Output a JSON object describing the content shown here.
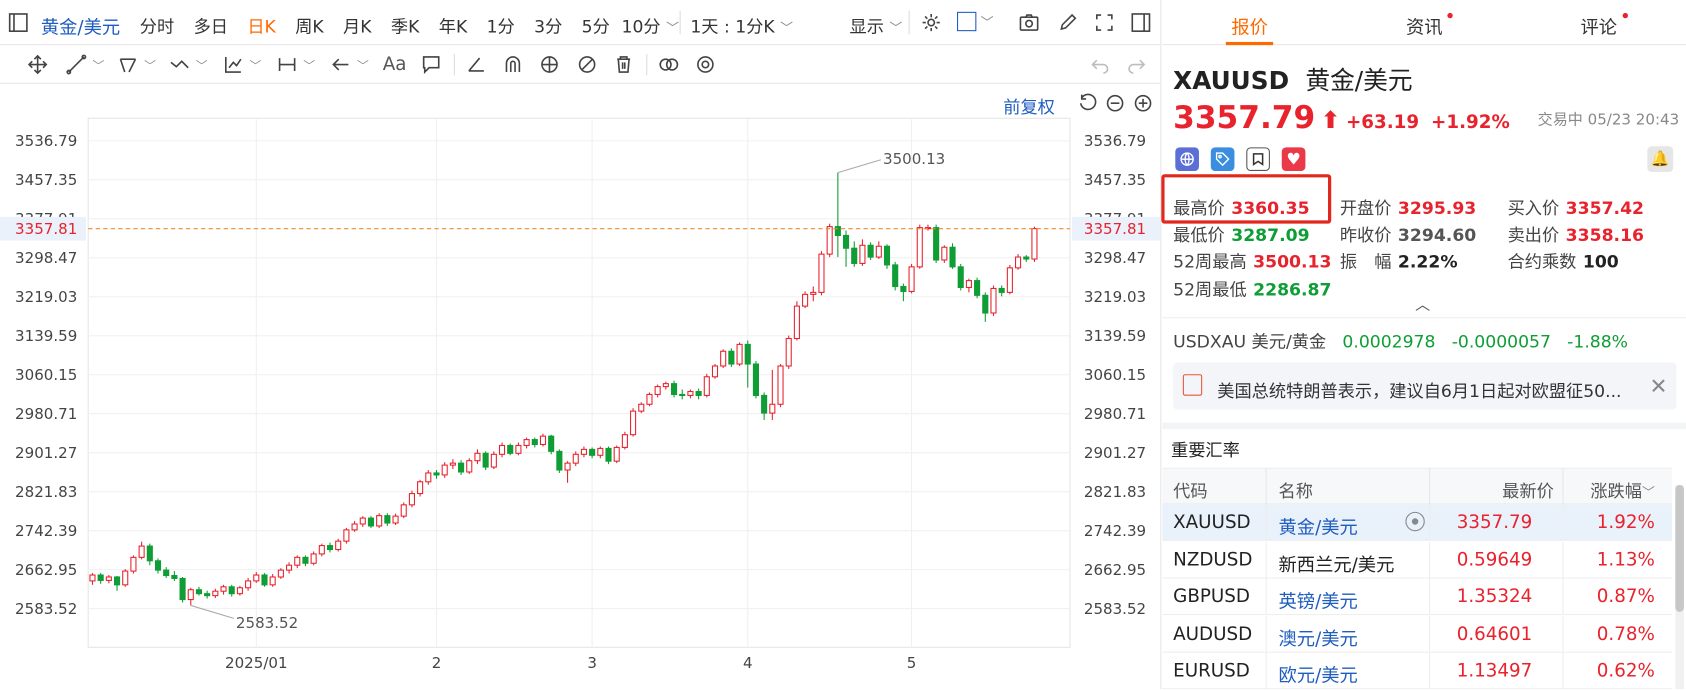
{
  "toolbar": {
    "symbol_pair": "黄金/美元",
    "periods": [
      "分时",
      "多日",
      "日K",
      "周K",
      "月K",
      "季K",
      "年K",
      "1分",
      "3分",
      "5分"
    ],
    "active_period": "日K",
    "dropdown_period": "10分",
    "range_select": "1天 : 1分K",
    "display_label": "显示"
  },
  "chart": {
    "adjust_label": "前复权",
    "price_line_label": "3357.81",
    "high_annotation": "3500.13",
    "low_annotation": "2583.52"
  },
  "chart_data": {
    "type": "candlestick",
    "y_ticks": [
      "3536.79",
      "3457.35",
      "3377.91",
      "3298.47",
      "3219.03",
      "3139.59",
      "3060.15",
      "2980.71",
      "2901.27",
      "2821.83",
      "2742.39",
      "2662.95",
      "2583.52"
    ],
    "ylim": [
      2583.52,
      3536.79
    ],
    "x_ticks": [
      "2025/01",
      "2",
      "3",
      "4",
      "5"
    ],
    "x_tick_index": [
      20,
      42,
      61,
      80,
      100
    ],
    "current_price": 3357.81,
    "candles": [
      [
        2640,
        2652,
        2632,
        2656
      ],
      [
        2652,
        2641,
        2634,
        2656
      ],
      [
        2641,
        2648,
        2635,
        2652
      ],
      [
        2648,
        2632,
        2620,
        2650
      ],
      [
        2632,
        2660,
        2628,
        2664
      ],
      [
        2660,
        2688,
        2655,
        2692
      ],
      [
        2688,
        2711,
        2684,
        2720
      ],
      [
        2711,
        2681,
        2672,
        2716
      ],
      [
        2681,
        2662,
        2655,
        2686
      ],
      [
        2662,
        2651,
        2646,
        2668
      ],
      [
        2651,
        2645,
        2640,
        2660
      ],
      [
        2645,
        2602,
        2596,
        2648
      ],
      [
        2602,
        2622,
        2590,
        2626
      ],
      [
        2622,
        2614,
        2610,
        2628
      ],
      [
        2614,
        2610,
        2604,
        2620
      ],
      [
        2610,
        2619,
        2605,
        2624
      ],
      [
        2619,
        2628,
        2612,
        2632
      ],
      [
        2628,
        2614,
        2608,
        2632
      ],
      [
        2614,
        2626,
        2610,
        2630
      ],
      [
        2626,
        2640,
        2620,
        2646
      ],
      [
        2640,
        2652,
        2636,
        2658
      ],
      [
        2652,
        2632,
        2628,
        2656
      ],
      [
        2632,
        2648,
        2628,
        2654
      ],
      [
        2648,
        2662,
        2644,
        2666
      ],
      [
        2662,
        2672,
        2655,
        2678
      ],
      [
        2672,
        2688,
        2666,
        2692
      ],
      [
        2688,
        2676,
        2670,
        2692
      ],
      [
        2676,
        2695,
        2672,
        2700
      ],
      [
        2695,
        2712,
        2690,
        2716
      ],
      [
        2712,
        2704,
        2698,
        2718
      ],
      [
        2704,
        2721,
        2700,
        2726
      ],
      [
        2721,
        2744,
        2716,
        2748
      ],
      [
        2744,
        2756,
        2740,
        2762
      ],
      [
        2756,
        2768,
        2750,
        2772
      ],
      [
        2768,
        2752,
        2748,
        2772
      ],
      [
        2752,
        2773,
        2748,
        2778
      ],
      [
        2773,
        2758,
        2752,
        2778
      ],
      [
        2758,
        2772,
        2754,
        2777
      ],
      [
        2772,
        2795,
        2768,
        2800
      ],
      [
        2795,
        2818,
        2790,
        2824
      ],
      [
        2818,
        2842,
        2812,
        2846
      ],
      [
        2842,
        2860,
        2836,
        2866
      ],
      [
        2860,
        2856,
        2848,
        2866
      ],
      [
        2856,
        2876,
        2850,
        2882
      ],
      [
        2876,
        2880,
        2868,
        2888
      ],
      [
        2880,
        2862,
        2856,
        2886
      ],
      [
        2862,
        2885,
        2858,
        2890
      ],
      [
        2885,
        2900,
        2878,
        2908
      ],
      [
        2900,
        2872,
        2866,
        2904
      ],
      [
        2872,
        2898,
        2868,
        2904
      ],
      [
        2898,
        2916,
        2892,
        2922
      ],
      [
        2916,
        2900,
        2896,
        2920
      ],
      [
        2900,
        2916,
        2896,
        2922
      ],
      [
        2916,
        2928,
        2910,
        2932
      ],
      [
        2928,
        2918,
        2912,
        2932
      ],
      [
        2918,
        2935,
        2914,
        2940
      ],
      [
        2935,
        2904,
        2898,
        2938
      ],
      [
        2904,
        2866,
        2860,
        2908
      ],
      [
        2866,
        2880,
        2840,
        2884
      ],
      [
        2880,
        2898,
        2874,
        2904
      ],
      [
        2898,
        2908,
        2892,
        2914
      ],
      [
        2908,
        2896,
        2890,
        2912
      ],
      [
        2896,
        2910,
        2890,
        2914
      ],
      [
        2910,
        2884,
        2878,
        2914
      ],
      [
        2884,
        2912,
        2880,
        2916
      ],
      [
        2912,
        2938,
        2908,
        2944
      ],
      [
        2938,
        2986,
        2934,
        2992
      ],
      [
        2986,
        3000,
        2982,
        3004
      ],
      [
        3000,
        3020,
        2996,
        3024
      ],
      [
        3020,
        3036,
        3014,
        3040
      ],
      [
        3036,
        3042,
        3030,
        3046
      ],
      [
        3042,
        3020,
        3014,
        3048
      ],
      [
        3020,
        3018,
        3010,
        3030
      ],
      [
        3018,
        3026,
        3012,
        3030
      ],
      [
        3026,
        3018,
        3010,
        3032
      ],
      [
        3018,
        3056,
        3014,
        3062
      ],
      [
        3056,
        3078,
        3052,
        3082
      ],
      [
        3078,
        3108,
        3074,
        3112
      ],
      [
        3108,
        3082,
        3076,
        3114
      ],
      [
        3082,
        3122,
        3078,
        3126
      ],
      [
        3122,
        3082,
        3034,
        3130
      ],
      [
        3082,
        3018,
        3012,
        3088
      ],
      [
        3018,
        2982,
        2968,
        3024
      ],
      [
        2982,
        3000,
        2968,
        3070
      ],
      [
        3000,
        3078,
        2994,
        3082
      ],
      [
        3078,
        3134,
        3072,
        3140
      ],
      [
        3134,
        3200,
        3130,
        3210
      ],
      [
        3200,
        3224,
        3196,
        3230
      ],
      [
        3224,
        3228,
        3210,
        3240
      ],
      [
        3228,
        3306,
        3222,
        3312
      ],
      [
        3306,
        3362,
        3300,
        3368
      ],
      [
        3362,
        3344,
        3300,
        3472
      ],
      [
        3344,
        3318,
        3280,
        3354
      ],
      [
        3318,
        3287,
        3280,
        3332
      ],
      [
        3287,
        3324,
        3282,
        3336
      ],
      [
        3324,
        3300,
        3294,
        3330
      ],
      [
        3300,
        3322,
        3296,
        3332
      ],
      [
        3322,
        3284,
        3276,
        3326
      ],
      [
        3284,
        3240,
        3232,
        3290
      ],
      [
        3240,
        3230,
        3210,
        3246
      ],
      [
        3230,
        3280,
        3226,
        3286
      ],
      [
        3280,
        3360,
        3276,
        3366
      ],
      [
        3360,
        3360,
        3354,
        3366
      ],
      [
        3360,
        3294,
        3288,
        3366
      ],
      [
        3294,
        3320,
        3288,
        3324
      ],
      [
        3320,
        3280,
        3276,
        3328
      ],
      [
        3280,
        3238,
        3232,
        3286
      ],
      [
        3238,
        3252,
        3228,
        3256
      ],
      [
        3252,
        3222,
        3216,
        3258
      ],
      [
        3222,
        3186,
        3168,
        3228
      ],
      [
        3186,
        3236,
        3180,
        3242
      ],
      [
        3236,
        3228,
        3220,
        3242
      ],
      [
        3228,
        3278,
        3224,
        3284
      ],
      [
        3278,
        3300,
        3274,
        3306
      ],
      [
        3300,
        3296,
        3290,
        3304
      ],
      [
        3296,
        3358,
        3290,
        3362
      ]
    ]
  },
  "quote": {
    "tabs": [
      {
        "label": "报价",
        "active": true
      },
      {
        "label": "资讯",
        "dot": true
      },
      {
        "label": "评论",
        "dot": true
      }
    ],
    "code": "XAUUSD",
    "name": "黄金/美元",
    "price": "3357.79",
    "change": "+63.19",
    "change_pct": "+1.92%",
    "status": "交易中 05/23 20:43",
    "stats": [
      {
        "label": "最高价",
        "value": "3360.35",
        "color": "red"
      },
      {
        "label": "开盘价",
        "value": "3295.93",
        "color": "red"
      },
      {
        "label": "买入价",
        "value": "3357.42",
        "color": "red"
      },
      {
        "label": "最低价",
        "value": "3287.09",
        "color": "green"
      },
      {
        "label": "昨收价",
        "value": "3294.60",
        "color": "gray"
      },
      {
        "label": "卖出价",
        "value": "3358.16",
        "color": "red"
      },
      {
        "label": "52周最高",
        "value": "3500.13",
        "color": "red"
      },
      {
        "label": "振　幅",
        "value": "2.22%",
        "color": "dark"
      },
      {
        "label": "合约乘数",
        "value": "100",
        "color": "dark"
      },
      {
        "label": "52周最低",
        "value": "2286.87",
        "color": "green"
      }
    ],
    "inverse": {
      "code": "USDXAU",
      "name": "美元/黄金",
      "price": "0.0002978",
      "change": "-0.0000057",
      "pct": "-1.88%"
    },
    "news": "美国总统特朗普表示，建议自6月1日起对欧盟征50..."
  },
  "rates": {
    "title": "重要汇率",
    "headers": {
      "code": "代码",
      "name": "名称",
      "price": "最新价",
      "chg": "涨跌幅"
    },
    "rows": [
      {
        "code": "XAUUSD",
        "name": "黄金/美元",
        "price": "3357.79",
        "chg": "1.92%",
        "link": true
      },
      {
        "code": "NZDUSD",
        "name": "新西兰元/美元",
        "price": "0.59649",
        "chg": "1.13%",
        "link": false
      },
      {
        "code": "GBPUSD",
        "name": "英镑/美元",
        "price": "1.35324",
        "chg": "0.87%",
        "link": true
      },
      {
        "code": "AUDUSD",
        "name": "澳元/美元",
        "price": "0.64601",
        "chg": "0.78%",
        "link": true
      },
      {
        "code": "EURUSD",
        "name": "欧元/美元",
        "price": "1.13497",
        "chg": "0.62%",
        "link": true
      }
    ]
  },
  "colors": {
    "up": "#e8232d",
    "down": "#0f9d35",
    "link": "#1f5dbf",
    "accent": "#ff6a00",
    "highlight": "#e2271c"
  }
}
